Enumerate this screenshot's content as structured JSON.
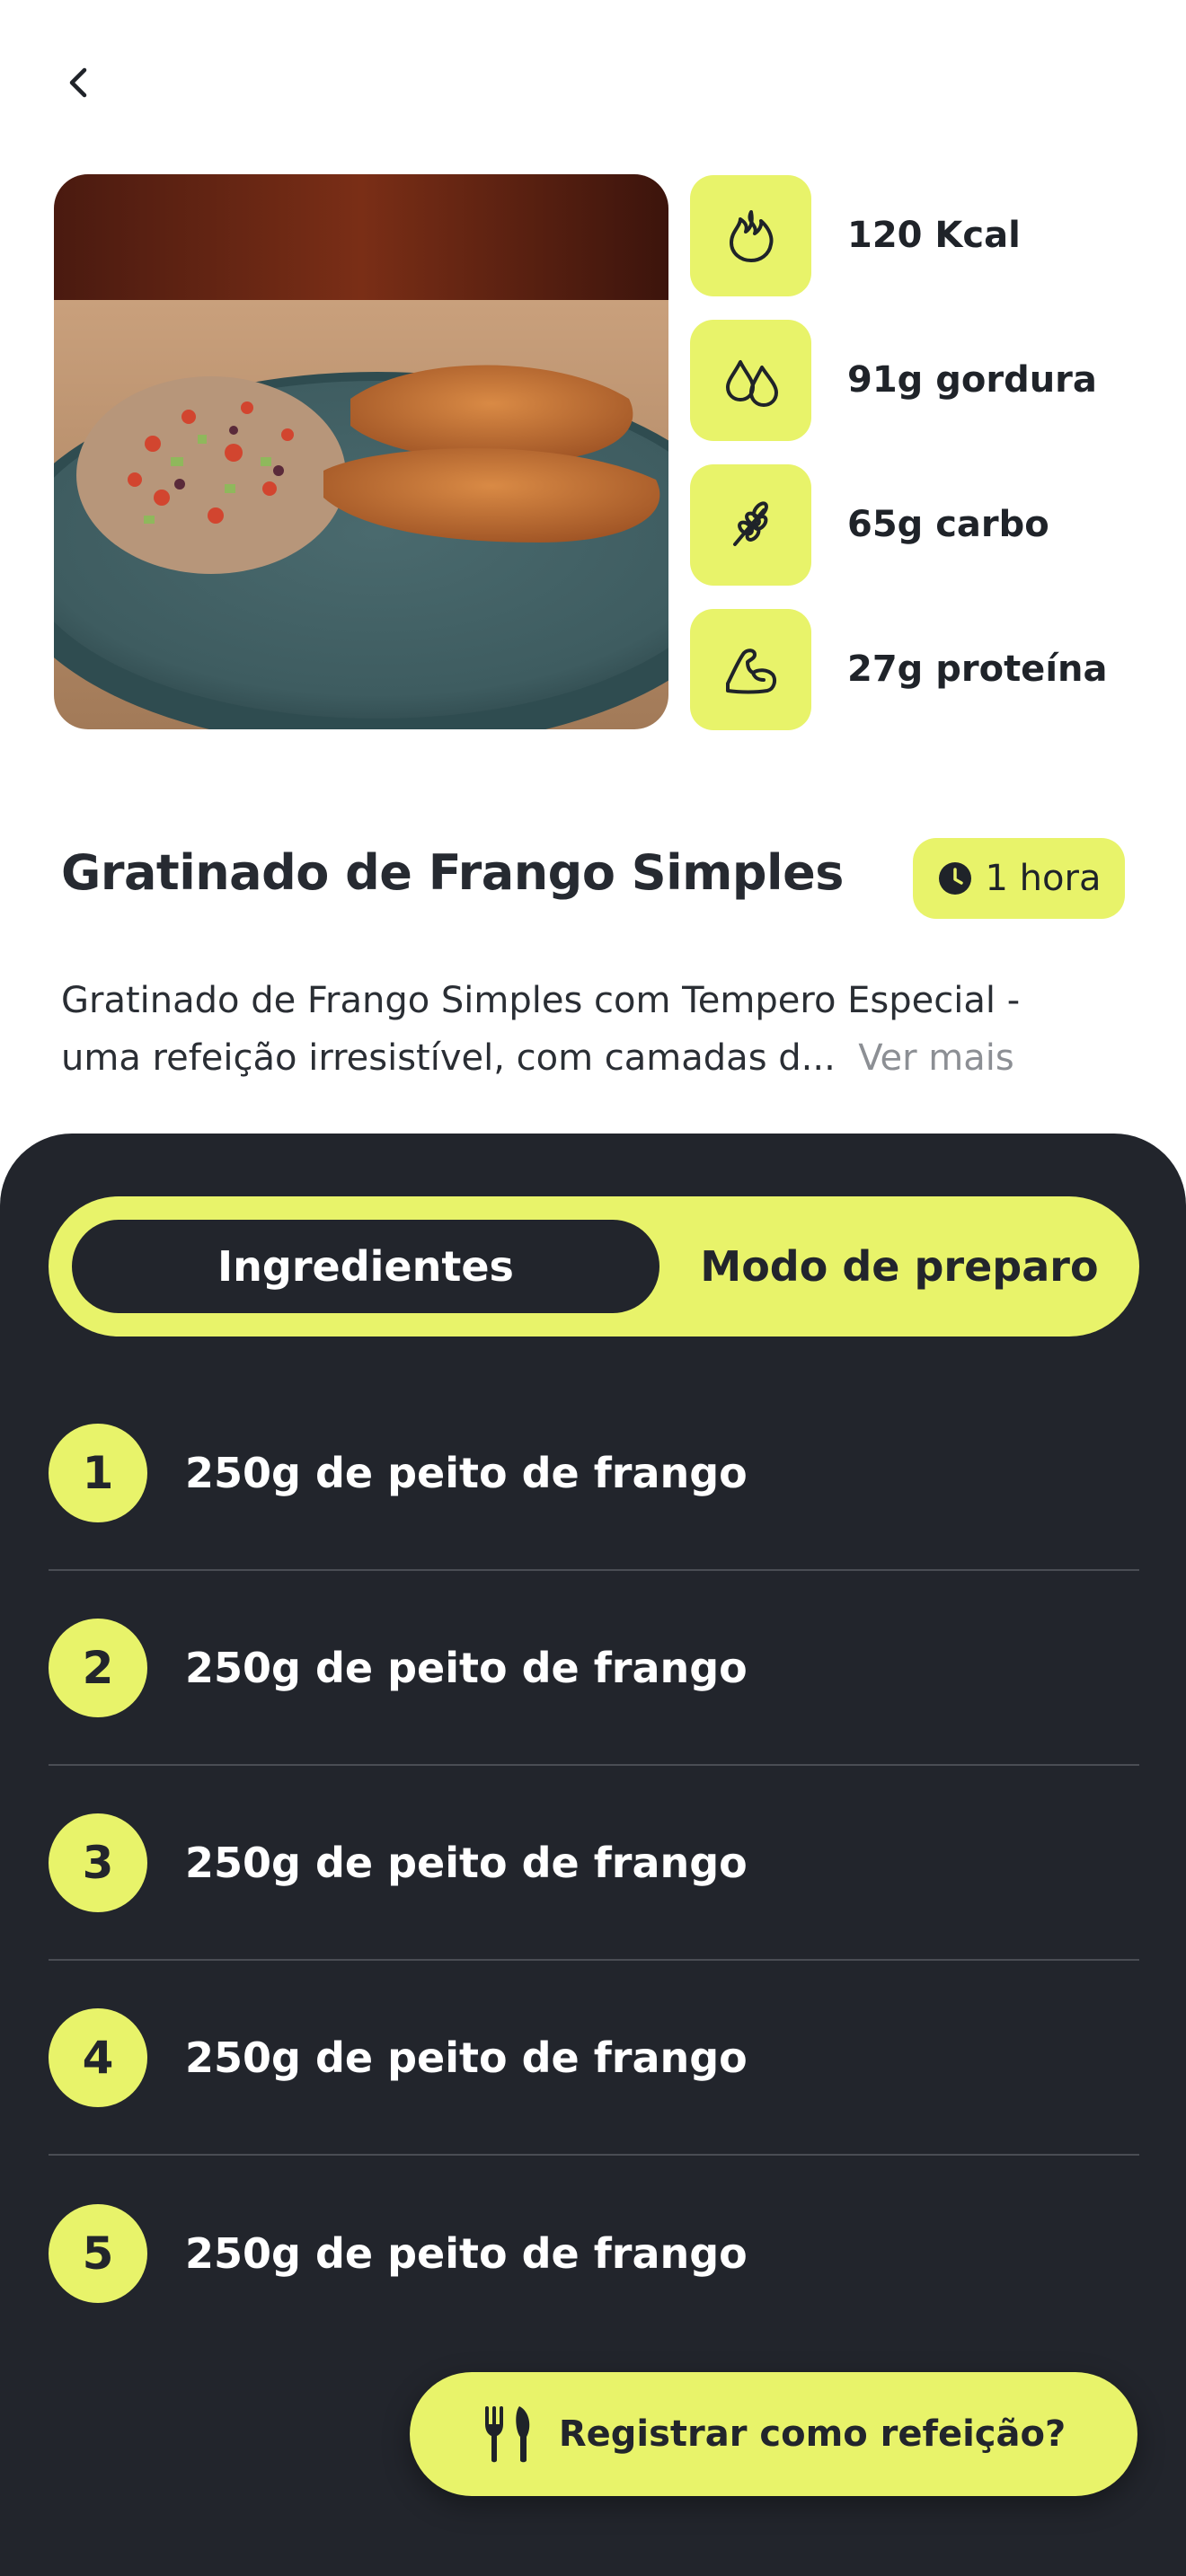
{
  "header": {
    "back_icon": "chevron-left-icon"
  },
  "hero": {
    "image_alt": "chicken-with-quinoa-salad"
  },
  "nutrition": [
    {
      "icon": "flame-icon",
      "label": "120 Kcal"
    },
    {
      "icon": "droplets-icon",
      "label": "91g gordura"
    },
    {
      "icon": "wheat-icon",
      "label": "65g carbo"
    },
    {
      "icon": "muscle-arm-icon",
      "label": "27g proteína"
    }
  ],
  "recipe": {
    "title": "Gratinado de Frango Simples",
    "time": "1 hora",
    "description_line1": "Gratinado de Frango Simples com Tempero Especial -",
    "description_line2": "uma refeição irresistível, com camadas d...",
    "more_label": "Ver mais"
  },
  "tabs": [
    {
      "label": "Ingredientes",
      "active": true
    },
    {
      "label": "Modo de preparo",
      "active": false
    }
  ],
  "ingredients": [
    {
      "number": "1",
      "text": "250g de peito de frango"
    },
    {
      "number": "2",
      "text": "250g de peito de frango"
    },
    {
      "number": "3",
      "text": "250g de peito de frango"
    },
    {
      "number": "4",
      "text": "250g de peito de frango"
    },
    {
      "number": "5",
      "text": "250g de peito de frango"
    }
  ],
  "cta": {
    "label": "Registrar como refeição?",
    "icon": "cutlery-icon"
  },
  "colors": {
    "accent": "#e8f36a",
    "dark": "#22252c",
    "text": "#262a31",
    "muted": "#8c8f94"
  }
}
